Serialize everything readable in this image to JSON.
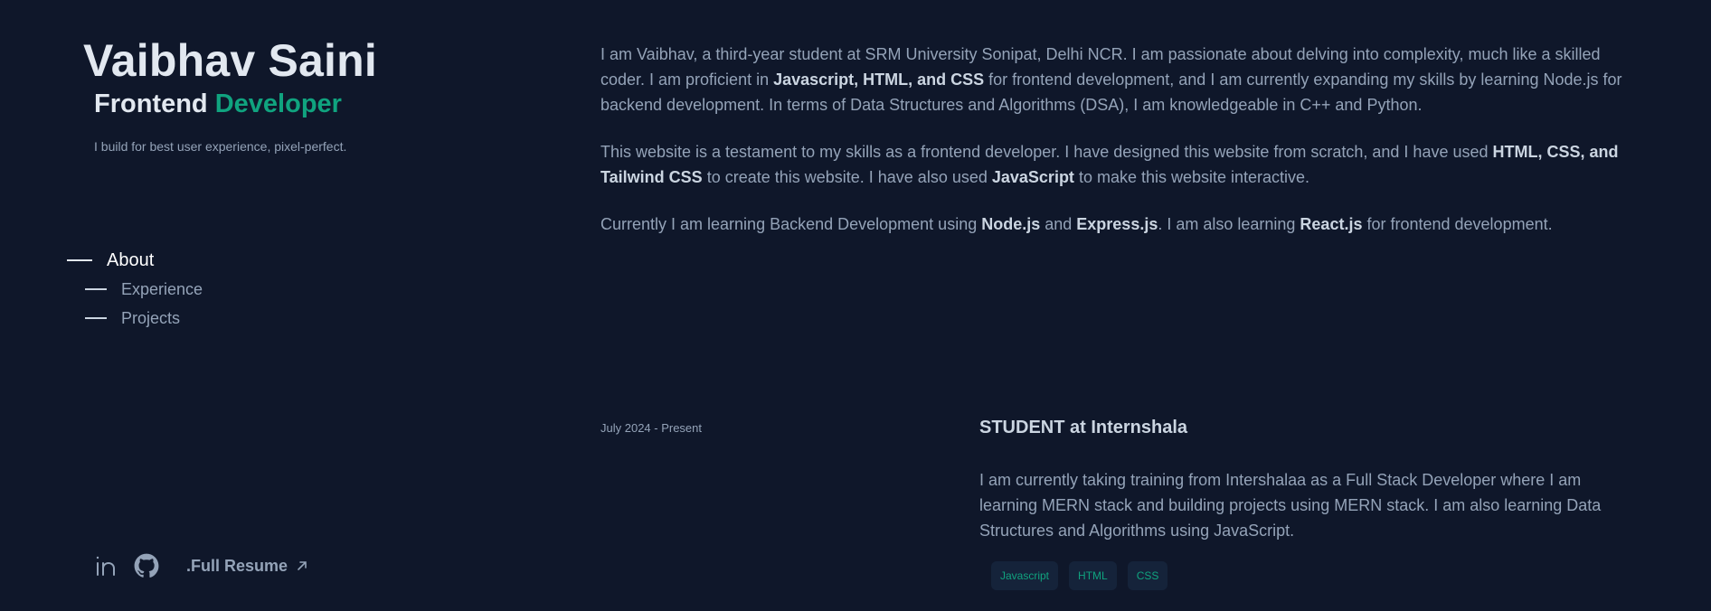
{
  "header": {
    "name": "Vaibhav Saini",
    "role_main": "Frontend",
    "role_accent": "Developer",
    "tagline": "I build for best user experience, pixel-perfect."
  },
  "nav": {
    "items": [
      {
        "label": "About",
        "active": true
      },
      {
        "label": "Experience",
        "active": false
      },
      {
        "label": "Projects",
        "active": false
      }
    ]
  },
  "footer": {
    "social": [
      {
        "icon": "linkedin-icon"
      },
      {
        "icon": "github-icon"
      }
    ],
    "resume_label": ".Full Resume",
    "resume_icon": "arrow-up-right-icon"
  },
  "about": {
    "p1": {
      "t1": "I am Vaibhav, a third-year student at SRM University Sonipat, Delhi NCR. I am passionate about delving into complexity, much like a skilled coder. I am proficient in ",
      "b1": "Javascript, HTML, and CSS",
      "t2": " for frontend development, and I am currently expanding my skills by learning Node.js for backend development. In terms of Data Structures and Algorithms (DSA), I am knowledgeable in C++ and Python."
    },
    "p2": {
      "t1": "This website is a testament to my skills as a frontend developer. I have designed this website from scratch, and I have used ",
      "b1": "HTML, CSS, and Tailwind CSS",
      "t2": " to create this website. I have also used ",
      "b2": "JavaScript",
      "t3": " to make this website interactive."
    },
    "p3": {
      "t1": "Currently I am learning Backend Development using ",
      "b1": "Node.js",
      "t2": " and ",
      "b2": "Express.js",
      "t3": ". I am also learning ",
      "b3": "React.js",
      "t4": " for frontend development."
    }
  },
  "experience": {
    "date": "July 2024 - Present",
    "title": "STUDENT at Internshala",
    "description": "I am currently taking training from Intershalaa as a Full Stack Developer where I am learning MERN stack and building projects using MERN stack. I am also learning Data Structures and Algorithms using JavaScript.",
    "tags": [
      "Javascript",
      "HTML",
      "CSS"
    ]
  },
  "colors": {
    "background": "#0f172a",
    "accent": "#10a37f",
    "text_primary": "#e2e8f0",
    "text_muted": "#94a3b8"
  }
}
